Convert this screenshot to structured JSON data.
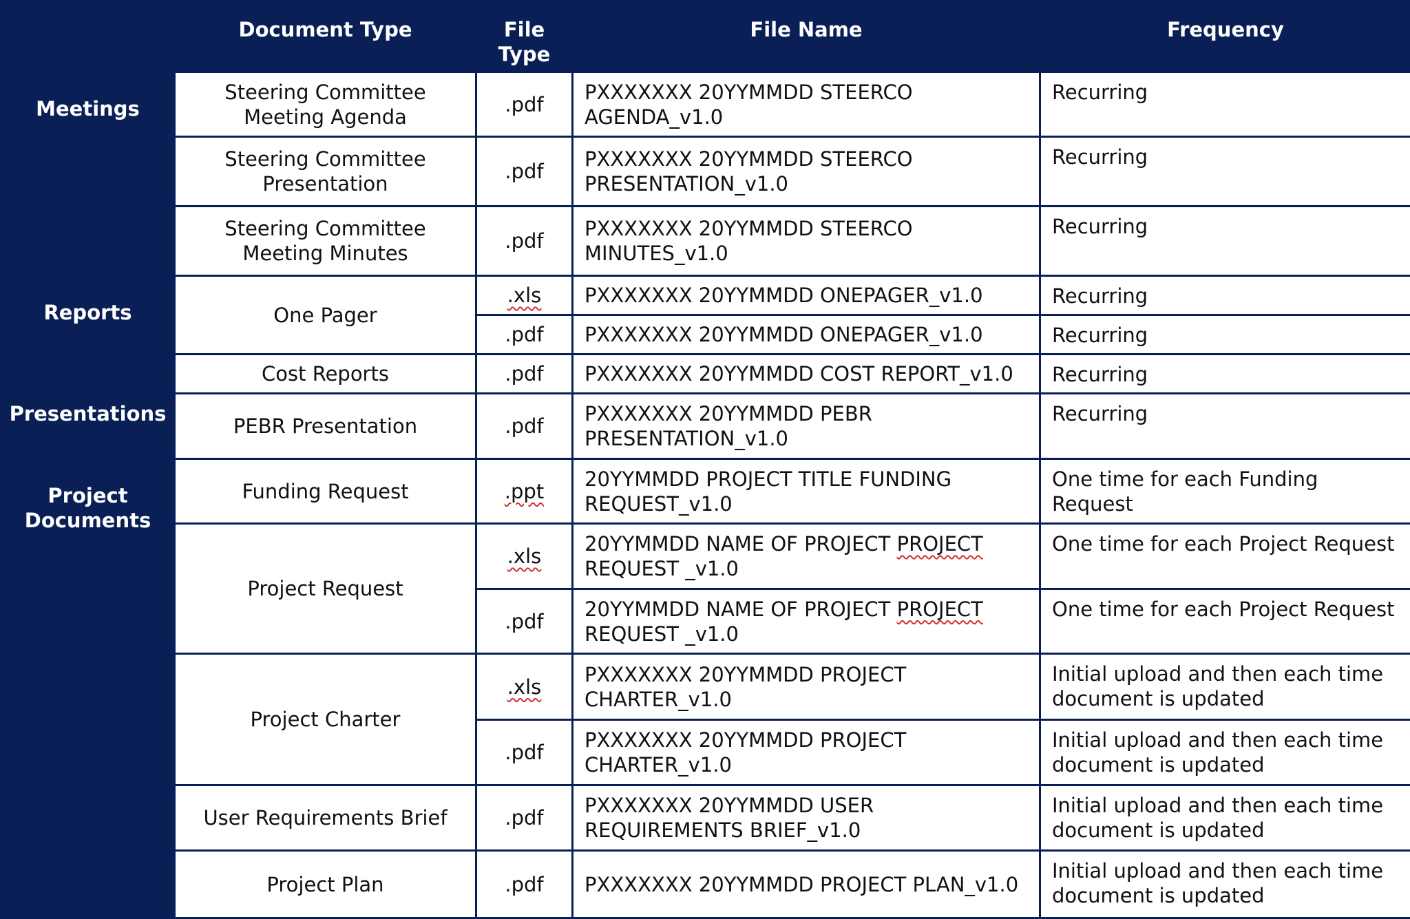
{
  "headers": {
    "category": "",
    "document_type": "Document Type",
    "file_type": "File Type",
    "file_name": "File Name",
    "frequency": "Frequency"
  },
  "categories": {
    "meetings": "Meetings",
    "reports": "Reports",
    "presentations": "Presentations",
    "project_documents": "Project Documents"
  },
  "documents": {
    "steerco_agenda": "Steering Committee Meeting Agenda",
    "steerco_presentation": "Steering Committee Presentation",
    "steerco_minutes": "Steering Committee Meeting Minutes",
    "one_pager": "One Pager",
    "cost_reports": "Cost Reports",
    "pebr_presentation": "PEBR Presentation",
    "funding_request": "Funding Request",
    "project_request": "Project Request",
    "project_charter": "Project Charter",
    "user_requirements_brief": "User Requirements Brief",
    "project_plan": "Project Plan"
  },
  "rows": [
    {
      "file_type": ".pdf",
      "file_name": "PXXXXXXX 20YYMMDD STEERCO AGENDA_v1.0",
      "frequency": "Recurring"
    },
    {
      "file_type": ".pdf",
      "file_name": "PXXXXXXX 20YYMMDD STEERCO PRESENTATION_v1.0",
      "frequency": "Recurring"
    },
    {
      "file_type": ".pdf",
      "file_name": "PXXXXXXX 20YYMMDD STEERCO MINUTES_v1.0",
      "frequency": "Recurring"
    },
    {
      "file_type": ".xls",
      "file_name": "PXXXXXXX 20YYMMDD ONEPAGER_v1.0",
      "frequency": "Recurring"
    },
    {
      "file_type": ".pdf",
      "file_name": "PXXXXXXX 20YYMMDD ONEPAGER_v1.0",
      "frequency": "Recurring"
    },
    {
      "file_type": ".pdf",
      "file_name": "PXXXXXXX 20YYMMDD COST REPORT_v1.0",
      "frequency": "Recurring"
    },
    {
      "file_type": ".pdf",
      "file_name": "PXXXXXXX 20YYMMDD PEBR PRESENTATION_v1.0",
      "frequency": "Recurring"
    },
    {
      "file_type": ".ppt",
      "file_name": "20YYMMDD PROJECT TITLE FUNDING REQUEST_v1.0",
      "frequency": "One time for each Funding Request"
    },
    {
      "file_type": ".xls",
      "file_name_pre": "20YYMMDD NAME OF PROJECT ",
      "file_name_flag": "PROJECT",
      "file_name_post": " REQUEST _v1.0",
      "frequency": "One time for each Project Request"
    },
    {
      "file_type": ".pdf",
      "file_name_pre": "20YYMMDD NAME OF PROJECT ",
      "file_name_flag": "PROJECT",
      "file_name_post": " REQUEST _v1.0",
      "frequency": "One time for each Project Request"
    },
    {
      "file_type": ".xls",
      "file_name": "PXXXXXXX 20YYMMDD PROJECT CHARTER_v1.0",
      "frequency": "Initial upload and then each time document is updated"
    },
    {
      "file_type": ".pdf",
      "file_name": "PXXXXXXX 20YYMMDD PROJECT CHARTER_v1.0",
      "frequency": "Initial upload and then each time document is updated"
    },
    {
      "file_type": ".pdf",
      "file_name": "PXXXXXXX 20YYMMDD USER REQUIREMENTS BRIEF_v1.0",
      "frequency": "Initial upload and then each time document is updated"
    },
    {
      "file_type": ".pdf",
      "file_name": "PXXXXXXX 20YYMMDD PROJECT PLAN_v1.0",
      "frequency": "Initial upload and then each time document is updated"
    }
  ]
}
